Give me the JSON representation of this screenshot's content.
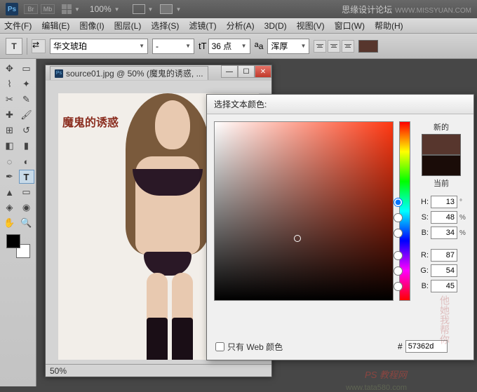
{
  "titlebar": {
    "zoom": "100%",
    "slogan": "思缘设计论坛",
    "slogan_url": "WWW.MISSYUAN.COM"
  },
  "menu": [
    "文件(F)",
    "编辑(E)",
    "图像(I)",
    "图层(L)",
    "选择(S)",
    "滤镜(T)",
    "分析(A)",
    "3D(D)",
    "视图(V)",
    "窗口(W)",
    "帮助(H)"
  ],
  "options": {
    "tool_letter": "T",
    "font_family": "华文琥珀",
    "font_style": "-",
    "font_size": "36 点",
    "aa_label": "浑厚"
  },
  "document": {
    "tab": "source01.jpg @ 50% (魔鬼的诱惑, ...",
    "stamp": "魔鬼的诱惑",
    "zoom": "50%"
  },
  "picker": {
    "title": "选择文本颜色:",
    "new_label": "新的",
    "current_label": "当前",
    "H": "13",
    "S": "48",
    "B": "34",
    "R": "87",
    "G": "54",
    "Bv": "45",
    "hex": "57362d",
    "webonly": "只有 Web 颜色"
  },
  "watermarks": {
    "side": "他她我帮你",
    "link": "PS 教程网",
    "faint": "www.tata580.com"
  }
}
